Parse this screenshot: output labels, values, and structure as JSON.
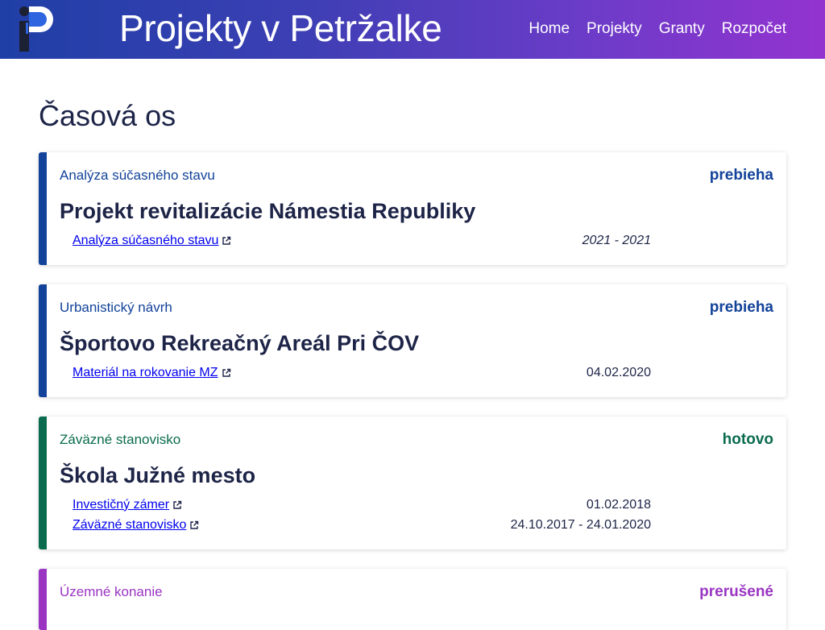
{
  "header": {
    "title": "Projekty v Petržalke",
    "nav": [
      {
        "label": "Home"
      },
      {
        "label": "Projekty"
      },
      {
        "label": "Granty"
      },
      {
        "label": "Rozpočet"
      }
    ]
  },
  "main": {
    "title": "Časová os"
  },
  "colors": {
    "in_progress": "#12429a",
    "done": "#0a6b4e",
    "interrupted": "#9a35c2"
  },
  "cards": [
    {
      "phase": "Analýza súčasného stavu",
      "status": "prebieha",
      "title": "Projekt revitalizácie Námestia Republiky",
      "docs": [
        {
          "name": "Analýza súčasného stavu",
          "date": "2021 - 2021"
        }
      ]
    },
    {
      "phase": "Urbanistický návrh",
      "status": "prebieha",
      "title": "Športovo Rekreačný Areál Pri ČOV",
      "docs": [
        {
          "name": "Materiál na rokovanie MZ",
          "date": "04.02.2020"
        }
      ]
    },
    {
      "phase": "Záväzné stanovisko",
      "status": "hotovo",
      "title": "Škola Južné mesto",
      "docs": [
        {
          "name": "Investičný zámer",
          "date": "01.02.2018"
        },
        {
          "name": "Záväzné stanovisko",
          "date": "24.10.2017 - 24.01.2020"
        }
      ]
    },
    {
      "phase": "Územné konanie",
      "status": "prerušené",
      "title": "",
      "docs": []
    }
  ]
}
